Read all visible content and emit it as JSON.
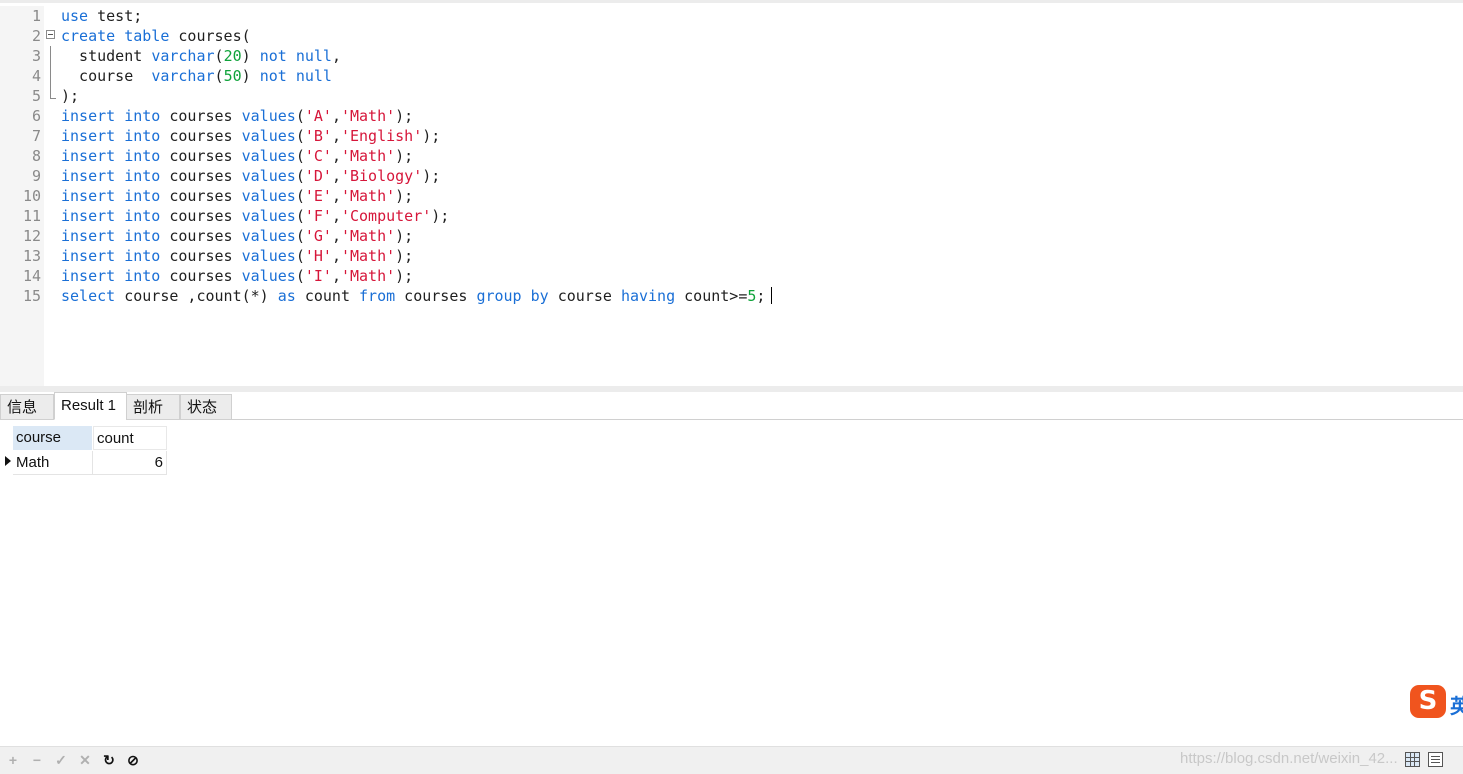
{
  "editor": {
    "lines": [
      {
        "no": "1",
        "tokens": [
          [
            "kw",
            "use"
          ],
          [
            "t",
            " test;"
          ]
        ]
      },
      {
        "no": "2",
        "fold": "start",
        "tokens": [
          [
            "kw",
            "create"
          ],
          [
            "t",
            " "
          ],
          [
            "kw",
            "table"
          ],
          [
            "t",
            " courses("
          ]
        ]
      },
      {
        "no": "3",
        "fold": "mid",
        "tokens": [
          [
            "t",
            "  student "
          ],
          [
            "kw",
            "varchar"
          ],
          [
            "t",
            "("
          ],
          [
            "num",
            "20"
          ],
          [
            "t",
            ") "
          ],
          [
            "kw",
            "not"
          ],
          [
            "t",
            " "
          ],
          [
            "kw",
            "null"
          ],
          [
            "t",
            ","
          ]
        ]
      },
      {
        "no": "4",
        "fold": "mid",
        "tokens": [
          [
            "t",
            "  course  "
          ],
          [
            "kw",
            "varchar"
          ],
          [
            "t",
            "("
          ],
          [
            "num",
            "50"
          ],
          [
            "t",
            ") "
          ],
          [
            "kw",
            "not"
          ],
          [
            "t",
            " "
          ],
          [
            "kw",
            "null"
          ]
        ]
      },
      {
        "no": "5",
        "fold": "end",
        "tokens": [
          [
            "t",
            ");"
          ]
        ]
      },
      {
        "no": "6",
        "tokens": [
          [
            "kw",
            "insert"
          ],
          [
            "t",
            " "
          ],
          [
            "kw",
            "into"
          ],
          [
            "t",
            " courses "
          ],
          [
            "kw",
            "values"
          ],
          [
            "t",
            "("
          ],
          [
            "str",
            "'A'"
          ],
          [
            "t",
            ","
          ],
          [
            "str",
            "'Math'"
          ],
          [
            "t",
            ");"
          ]
        ]
      },
      {
        "no": "7",
        "tokens": [
          [
            "kw",
            "insert"
          ],
          [
            "t",
            " "
          ],
          [
            "kw",
            "into"
          ],
          [
            "t",
            " courses "
          ],
          [
            "kw",
            "values"
          ],
          [
            "t",
            "("
          ],
          [
            "str",
            "'B'"
          ],
          [
            "t",
            ","
          ],
          [
            "str",
            "'English'"
          ],
          [
            "t",
            ");"
          ]
        ]
      },
      {
        "no": "8",
        "tokens": [
          [
            "kw",
            "insert"
          ],
          [
            "t",
            " "
          ],
          [
            "kw",
            "into"
          ],
          [
            "t",
            " courses "
          ],
          [
            "kw",
            "values"
          ],
          [
            "t",
            "("
          ],
          [
            "str",
            "'C'"
          ],
          [
            "t",
            ","
          ],
          [
            "str",
            "'Math'"
          ],
          [
            "t",
            ");"
          ]
        ]
      },
      {
        "no": "9",
        "tokens": [
          [
            "kw",
            "insert"
          ],
          [
            "t",
            " "
          ],
          [
            "kw",
            "into"
          ],
          [
            "t",
            " courses "
          ],
          [
            "kw",
            "values"
          ],
          [
            "t",
            "("
          ],
          [
            "str",
            "'D'"
          ],
          [
            "t",
            ","
          ],
          [
            "str",
            "'Biology'"
          ],
          [
            "t",
            ");"
          ]
        ]
      },
      {
        "no": "10",
        "tokens": [
          [
            "kw",
            "insert"
          ],
          [
            "t",
            " "
          ],
          [
            "kw",
            "into"
          ],
          [
            "t",
            " courses "
          ],
          [
            "kw",
            "values"
          ],
          [
            "t",
            "("
          ],
          [
            "str",
            "'E'"
          ],
          [
            "t",
            ","
          ],
          [
            "str",
            "'Math'"
          ],
          [
            "t",
            ");"
          ]
        ]
      },
      {
        "no": "11",
        "tokens": [
          [
            "kw",
            "insert"
          ],
          [
            "t",
            " "
          ],
          [
            "kw",
            "into"
          ],
          [
            "t",
            " courses "
          ],
          [
            "kw",
            "values"
          ],
          [
            "t",
            "("
          ],
          [
            "str",
            "'F'"
          ],
          [
            "t",
            ","
          ],
          [
            "str",
            "'Computer'"
          ],
          [
            "t",
            ");"
          ]
        ]
      },
      {
        "no": "12",
        "tokens": [
          [
            "kw",
            "insert"
          ],
          [
            "t",
            " "
          ],
          [
            "kw",
            "into"
          ],
          [
            "t",
            " courses "
          ],
          [
            "kw",
            "values"
          ],
          [
            "t",
            "("
          ],
          [
            "str",
            "'G'"
          ],
          [
            "t",
            ","
          ],
          [
            "str",
            "'Math'"
          ],
          [
            "t",
            ");"
          ]
        ]
      },
      {
        "no": "13",
        "tokens": [
          [
            "kw",
            "insert"
          ],
          [
            "t",
            " "
          ],
          [
            "kw",
            "into"
          ],
          [
            "t",
            " courses "
          ],
          [
            "kw",
            "values"
          ],
          [
            "t",
            "("
          ],
          [
            "str",
            "'H'"
          ],
          [
            "t",
            ","
          ],
          [
            "str",
            "'Math'"
          ],
          [
            "t",
            ");"
          ]
        ]
      },
      {
        "no": "14",
        "tokens": [
          [
            "kw",
            "insert"
          ],
          [
            "t",
            " "
          ],
          [
            "kw",
            "into"
          ],
          [
            "t",
            " courses "
          ],
          [
            "kw",
            "values"
          ],
          [
            "t",
            "("
          ],
          [
            "str",
            "'I'"
          ],
          [
            "t",
            ","
          ],
          [
            "str",
            "'Math'"
          ],
          [
            "t",
            ");"
          ]
        ]
      },
      {
        "no": "15",
        "caret": true,
        "tokens": [
          [
            "kw",
            "select"
          ],
          [
            "t",
            " course ,count(*) "
          ],
          [
            "kw",
            "as"
          ],
          [
            "t",
            " count "
          ],
          [
            "kw",
            "from"
          ],
          [
            "t",
            " courses "
          ],
          [
            "kw",
            "group"
          ],
          [
            "t",
            " "
          ],
          [
            "kw",
            "by"
          ],
          [
            "t",
            " course "
          ],
          [
            "kw",
            "having"
          ],
          [
            "t",
            " count>="
          ],
          [
            "num",
            "5"
          ],
          [
            "t",
            ";"
          ]
        ]
      }
    ],
    "colors": {
      "keyword": "#1a6fd6",
      "string": "#d6163a",
      "number": "#0ea33a",
      "text": "#1f1f1f"
    }
  },
  "tabs": [
    {
      "label": "信息",
      "active": false
    },
    {
      "label": "Result 1",
      "active": true
    },
    {
      "label": "剖析",
      "active": false
    },
    {
      "label": "状态",
      "active": false
    }
  ],
  "result": {
    "columns": [
      "course",
      "count"
    ],
    "rows": [
      [
        "Math",
        "6"
      ]
    ]
  },
  "toolbar": {
    "icons": [
      "add-icon",
      "remove-icon",
      "check-icon",
      "cancel-icon",
      "refresh-icon",
      "stop-icon"
    ],
    "watermark": "https://blog.csdn.net/weixin_42..."
  },
  "ime": {
    "logo": "S",
    "text": "英"
  }
}
